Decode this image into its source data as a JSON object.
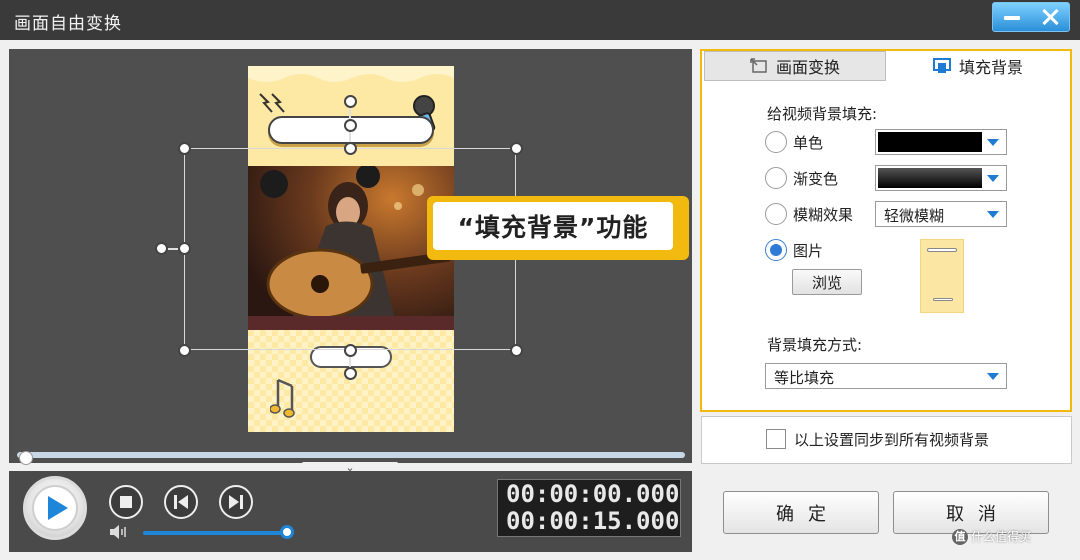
{
  "window": {
    "title": "画面自由变换",
    "minimize_icon": "minimize-icon",
    "close_icon": "close-icon",
    "accent_color": "#2a8fd8"
  },
  "preview": {
    "callout_text": "“填充背景”功能",
    "callout_color": "#f2b90f",
    "collapse_glyph": "⌄"
  },
  "playback": {
    "current_time": "00:00:00.000",
    "total_time": "00:00:15.000",
    "progress": 0,
    "volume": 1.0
  },
  "tabs": [
    {
      "label": "画面变换",
      "active": false,
      "icon": "transform-icon"
    },
    {
      "label": "填充背景",
      "active": true,
      "icon": "fill-background-icon"
    }
  ],
  "fill_background": {
    "section_label": "给视频背景填充:",
    "options": [
      {
        "label": "单色",
        "selected": false
      },
      {
        "label": "渐变色",
        "selected": false
      },
      {
        "label": "模糊效果",
        "selected": false
      },
      {
        "label": "图片",
        "selected": true
      }
    ],
    "solid_color_value": "#000000",
    "gradient_value": "black-gradient",
    "blur_value": "轻微模糊",
    "browse_label": "浏览",
    "mode_label": "背景填充方式:",
    "mode_value": "等比填充"
  },
  "sync": {
    "label": "以上设置同步到所有视频背景",
    "checked": false
  },
  "buttons": {
    "ok": "确定",
    "cancel": "取消"
  },
  "watermark": {
    "badge": "值",
    "text": "什么值得买"
  }
}
